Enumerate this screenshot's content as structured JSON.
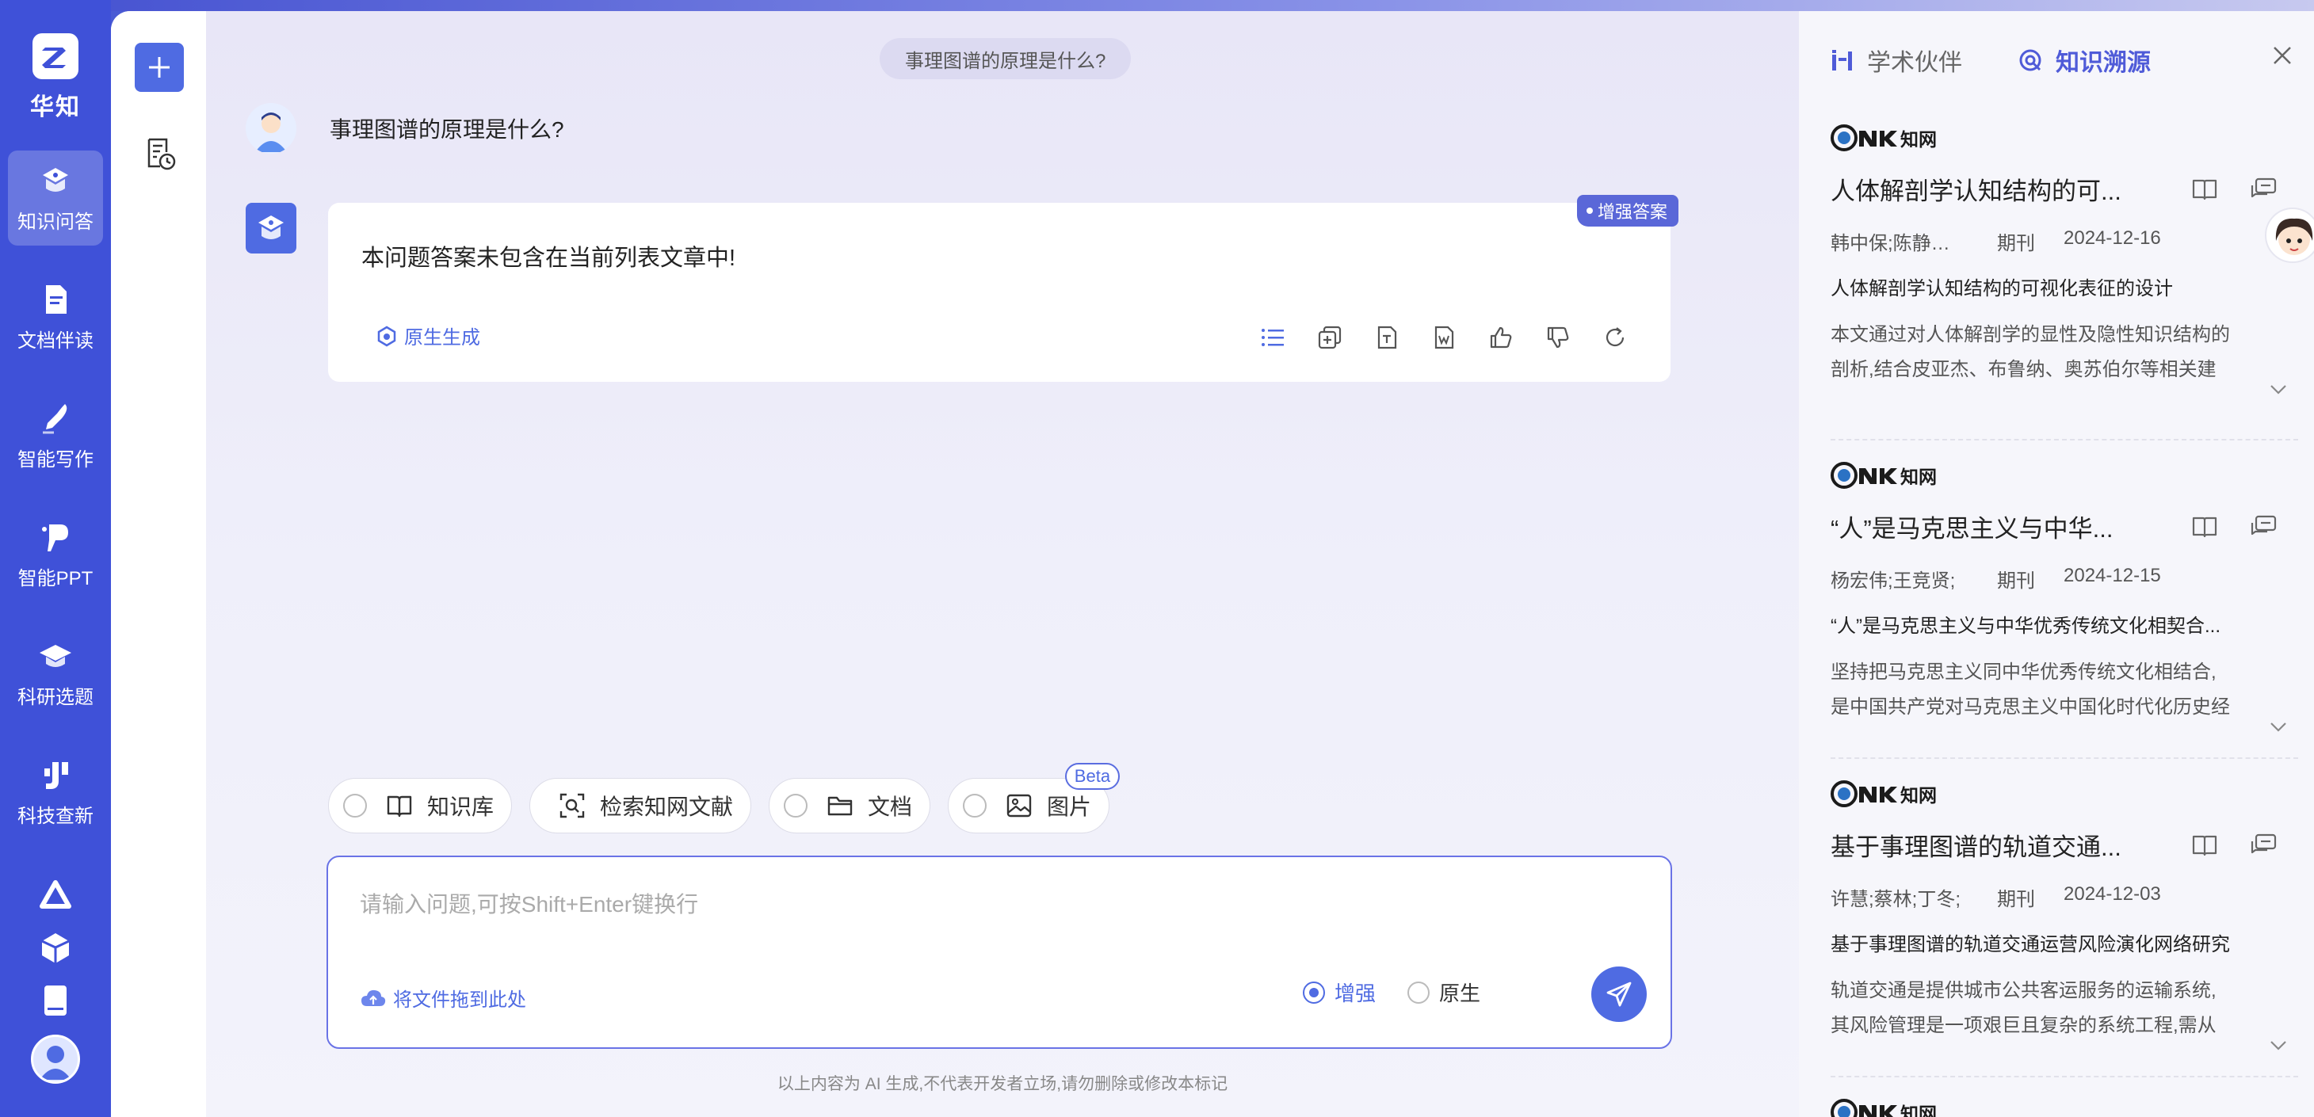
{
  "app": {
    "logo_text": "华知"
  },
  "nav": {
    "items": [
      {
        "label": "知识问答",
        "icon": "qa-icon",
        "active": true
      },
      {
        "label": "文档伴读",
        "icon": "document-icon",
        "active": false
      },
      {
        "label": "智能写作",
        "icon": "pen-icon",
        "active": false
      },
      {
        "label": "智能PPT",
        "icon": "ppt-icon",
        "active": false
      },
      {
        "label": "科研选题",
        "icon": "graduation-cap-icon",
        "active": false
      },
      {
        "label": "科技查新",
        "icon": "search-new-icon",
        "active": false
      }
    ]
  },
  "chat": {
    "question_pill": "事理图谱的原理是什么?",
    "user_question": "事理图谱的原理是什么?",
    "answer": {
      "badge": "增强答案",
      "text": "本问题答案未包含在当前列表文章中!",
      "native_gen_label": "原生生成"
    },
    "chips": [
      {
        "label": "知识库",
        "icon": "book-icon",
        "radio": true
      },
      {
        "label": "检索知网文献",
        "icon": "scan-search-icon",
        "radio": false
      },
      {
        "label": "文档",
        "icon": "folder-icon",
        "radio": true
      },
      {
        "label": "图片",
        "icon": "image-icon",
        "radio": true,
        "badge": "Beta"
      }
    ],
    "input": {
      "placeholder": "请输入问题,可按Shift+Enter键换行",
      "value": "",
      "drag_label": "将文件拖到此处",
      "mode_enhanced": "增强",
      "mode_native": "原生",
      "selected_mode": "增强"
    },
    "disclaimer": "以上内容为 AI 生成,不代表开发者立场,请勿删除或修改本标记"
  },
  "right_panel": {
    "tab_academic": "学术伙伴",
    "tab_trace": "知识溯源",
    "active_tab": "知识溯源",
    "source_logo_text": "知网",
    "refs": [
      {
        "title": "人体解剖学认知结构的可...",
        "authors": "韩中保;陈静云;...",
        "type": "期刊",
        "date": "2024-12-16",
        "subtitle": "人体解剖学认知结构的可视化表征的设计",
        "abstract": [
          "本文通过对人体解剖学的显性及隐性知识结构的",
          "剖析,结合皮亚杰、布鲁纳、奥苏伯尔等相关建"
        ]
      },
      {
        "title": "“人”是马克思主义与中华...",
        "authors": "杨宏伟;王竞贤;",
        "type": "期刊",
        "date": "2024-12-15",
        "subtitle": "“人”是马克思主义与中华优秀传统文化相契合...",
        "abstract": [
          "坚持把马克思主义同中华优秀传统文化相结合,",
          "是中国共产党对马克思主义中国化时代化历史经"
        ]
      },
      {
        "title": "基于事理图谱的轨道交通...",
        "authors": "许慧;蔡林;丁冬;",
        "type": "期刊",
        "date": "2024-12-03",
        "subtitle": "基于事理图谱的轨道交通运营风险演化网络研究",
        "abstract": [
          "轨道交通是提供城市公共客运服务的运输系统,",
          "其风险管理是一项艰巨且复杂的系统工程,需从"
        ]
      }
    ]
  }
}
